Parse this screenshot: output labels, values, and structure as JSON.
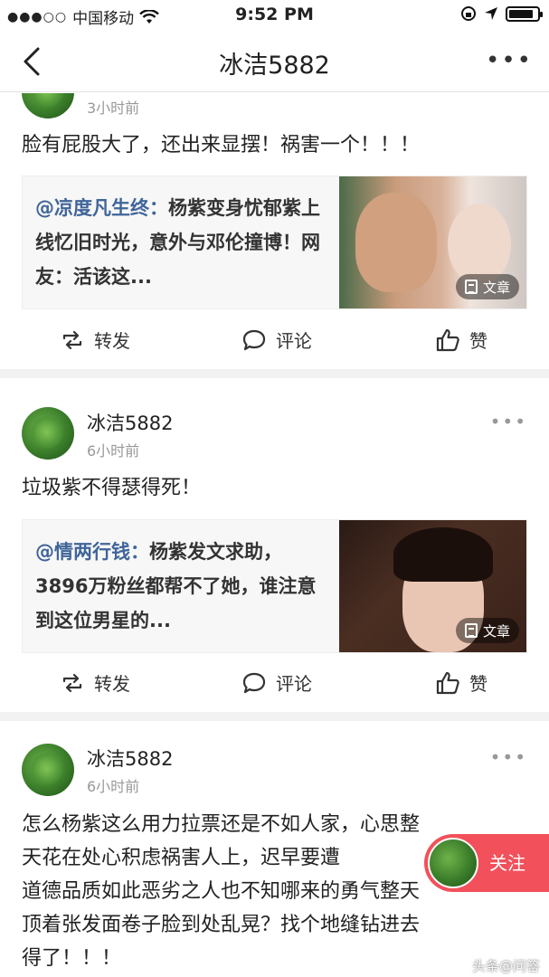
{
  "status_bar": {
    "signal": "●●●○○",
    "carrier": "中国移动",
    "wifi_icon": "wifi-icon",
    "time": "9:52 PM",
    "battery_icon": "battery-icon"
  },
  "nav": {
    "title": "冰洁5882",
    "back_icon": "chevron-left-icon",
    "more_label": "•••"
  },
  "posts": [
    {
      "user": "",
      "time": "3小时前",
      "content": "脸有屁股大了，还出来显摆！祸害一个！！！",
      "card": {
        "mention": "@凉度凡生终：",
        "text": "杨紫变身忧郁紫上线忆旧时光，意外与邓伦撞博！网友：活该这...",
        "badge": "文章"
      },
      "actions": {
        "forward": "转发",
        "comment": "评论",
        "like": "赞"
      }
    },
    {
      "user": "冰洁5882",
      "time": "6小时前",
      "content": "垃圾紫不得瑟得死！",
      "card": {
        "mention": "@情两行钱：",
        "text": "杨紫发文求助，3896万粉丝都帮不了她，谁注意到这位男星的...",
        "badge": "文章"
      },
      "actions": {
        "forward": "转发",
        "comment": "评论",
        "like": "赞"
      }
    },
    {
      "user": "冰洁5882",
      "time": "6小时前",
      "content_lines": [
        "怎么杨紫这么用力拉票还是不如人家，心思整",
        "天花在处心积虑祸害人上，迟早要遭",
        "道德品质如此恶劣之人也不知哪来的勇气整天",
        "顶着张发面卷子脸到处乱晃？找个地缝钻进去",
        "得了！！！"
      ]
    }
  ],
  "follow_button": {
    "label": "关注"
  },
  "watermark": "头条@问答"
}
